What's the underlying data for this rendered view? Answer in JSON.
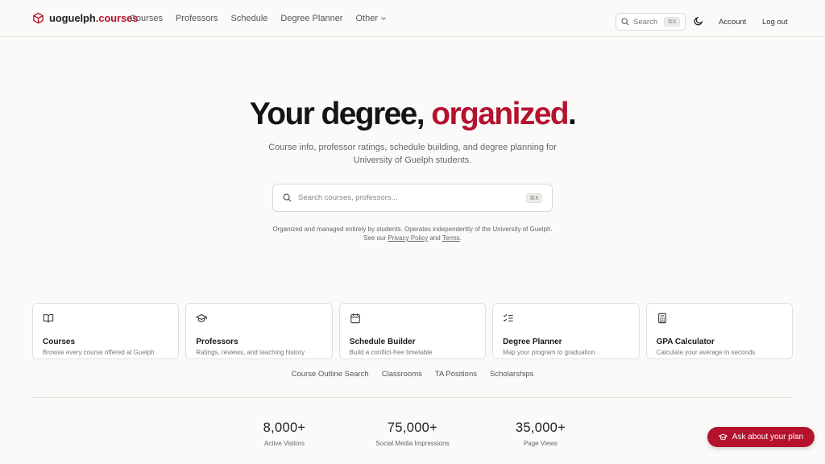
{
  "nav": {
    "logo_prefix": "uoguelph",
    "logo_suffix": ".courses",
    "links": [
      "Courses",
      "Professors",
      "Schedule",
      "Degree Planner",
      "Other"
    ],
    "search_label": "Search",
    "search_shortcut": "⌘K",
    "account": "Account",
    "logout": "Log out"
  },
  "hero": {
    "title_main": "Your degree, ",
    "title_accent": "organized",
    "title_end": ".",
    "subtitle": "Course info, professor ratings, schedule building, and degree planning for University of Guelph students.",
    "search_placeholder": "Search courses, professors...",
    "search_shortcut": "⌘K",
    "disclaimer_text": "Organized and managed entirely by students. Operates independently of the University of Guelph. See our ",
    "privacy_link": "Privacy Policy",
    "and_text": " and ",
    "terms_link": "Terms",
    "period": "."
  },
  "cards": [
    {
      "title": "Courses",
      "desc": "Browse every course offered at Guelph",
      "icon": "book-icon"
    },
    {
      "title": "Professors",
      "desc": "Ratings, reviews, and teaching history",
      "icon": "graduation-cap-icon"
    },
    {
      "title": "Schedule Builder",
      "desc": "Build a conflict-free timetable",
      "icon": "calendar-icon"
    },
    {
      "title": "Degree Planner",
      "desc": "Map your program to graduation",
      "icon": "checklist-icon"
    },
    {
      "title": "GPA Calculator",
      "desc": "Calculate your average in seconds",
      "icon": "calculator-icon"
    }
  ],
  "sublinks": [
    "Course Outline Search",
    "Classrooms",
    "TA Positions",
    "Scholarships"
  ],
  "stats": [
    {
      "value": "8,000+",
      "label": "Active Visitors"
    },
    {
      "value": "75,000+",
      "label": "Social Media Impressions"
    },
    {
      "value": "35,000+",
      "label": "Page Views"
    }
  ],
  "cta": {
    "label": "Ask about your plan"
  },
  "colors": {
    "accent": "#b5122e",
    "background": "#fbfaf8"
  }
}
